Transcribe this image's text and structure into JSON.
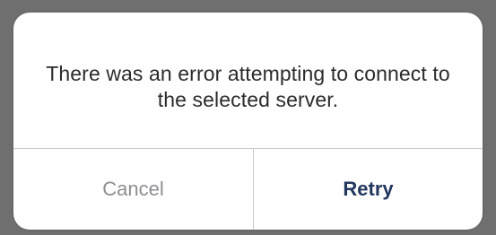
{
  "alert": {
    "message": "There was an error attempting to connect to the selected server.",
    "buttons": {
      "cancel_label": "Cancel",
      "retry_label": "Retry"
    }
  },
  "colors": {
    "backdrop": "#6f6f6f",
    "dialog_background": "#ffffff",
    "message_text": "#2b2b2b",
    "cancel_text": "#8e8e93",
    "retry_text": "#22375e",
    "divider": "#c8c8c8"
  }
}
